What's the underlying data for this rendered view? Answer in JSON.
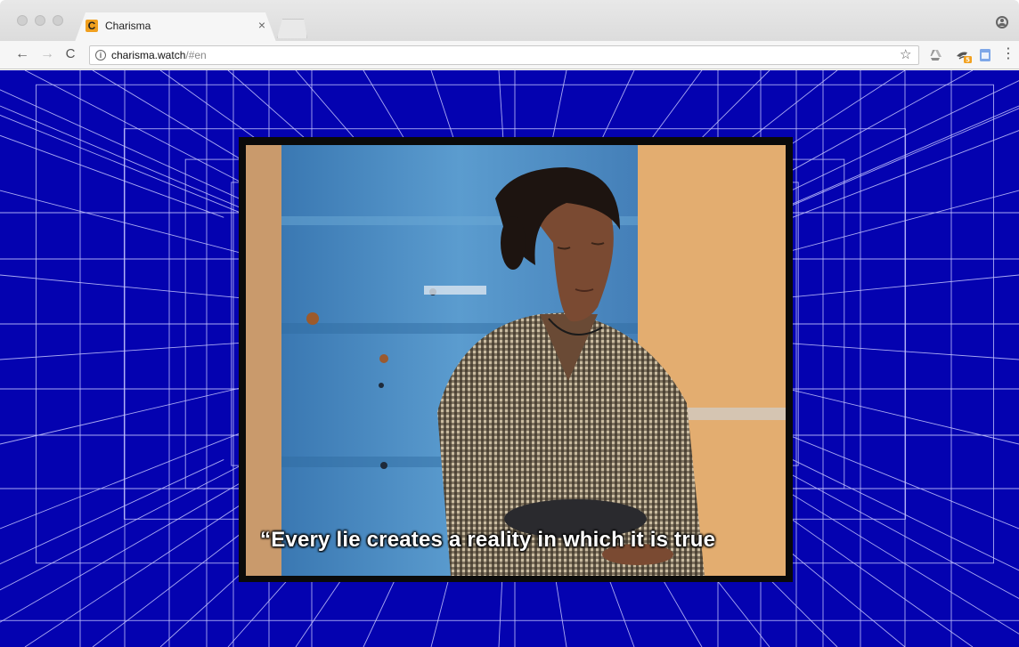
{
  "browser": {
    "tab": {
      "favicon_letter": "C",
      "title": "Charisma",
      "close_glyph": "×"
    },
    "toolbar": {
      "back_glyph": "←",
      "forward_glyph": "→",
      "reload_glyph": "C",
      "info_glyph": "i",
      "url_host": "charisma.watch",
      "url_path": "/#en",
      "star_glyph": "☆",
      "menu_glyph": "⋮",
      "extensions": [
        "google-drive-icon",
        "extension-bird-icon",
        "docs-icon"
      ],
      "extension_badge": "5"
    },
    "profile_icon": "profile-icon"
  },
  "page": {
    "background_color": "#0402b0",
    "grid_line_color": "#c8c8ff",
    "video": {
      "subtitle": "“Every lie creates a reality in which it is true"
    }
  }
}
